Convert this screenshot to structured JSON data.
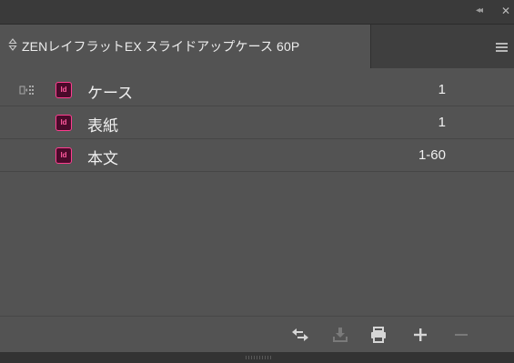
{
  "titlebar": {
    "collapse_label": "◂◂",
    "close_label": "✕"
  },
  "tab": {
    "title": "ZENレイフラットEX スライドアップケース 60P",
    "arrows_icon": "up-down-arrows-icon",
    "menu_icon": "panel-menu-icon"
  },
  "documents": [
    {
      "name": "ケース",
      "pages": "1",
      "icon": "indesign-doc-icon",
      "style_source": true
    },
    {
      "name": "表紙",
      "pages": "1",
      "icon": "indesign-doc-icon",
      "style_source": false
    },
    {
      "name": "本文",
      "pages": "1-60",
      "icon": "indesign-doc-icon",
      "style_source": false
    }
  ],
  "icon_label": "Id",
  "toolbar": {
    "buttons": [
      "synchronize-icon",
      "update-icon",
      "print-icon",
      "add-document-icon",
      "remove-document-icon"
    ]
  },
  "colors": {
    "panel_bg": "#535353",
    "titlebar_bg": "#3a3a3a",
    "indesign_pink": "#ff3d8f"
  }
}
